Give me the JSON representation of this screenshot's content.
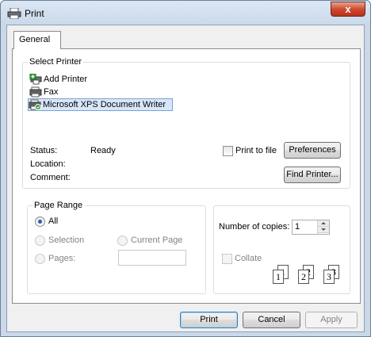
{
  "window": {
    "title": "Print",
    "close_symbol": "x"
  },
  "tabs": [
    {
      "label": "General"
    }
  ],
  "select_printer": {
    "group_label": "Select Printer",
    "printers": [
      {
        "label": "Add Printer",
        "icon": "add-printer-icon",
        "selected": false
      },
      {
        "label": "Fax",
        "icon": "fax-icon",
        "selected": false
      },
      {
        "label": "Microsoft XPS Document Writer",
        "icon": "printer-default-icon",
        "selected": true
      }
    ],
    "status_label": "Status:",
    "status_value": "Ready",
    "location_label": "Location:",
    "comment_label": "Comment:",
    "print_to_file_label": "Print to file",
    "print_to_file_checked": false,
    "preferences_label": "Preferences",
    "find_printer_label": "Find Printer..."
  },
  "page_range": {
    "group_label": "Page Range",
    "all_label": "All",
    "selection_label": "Selection",
    "current_page_label": "Current Page",
    "pages_label": "Pages:",
    "pages_value": "",
    "selected_option": "All"
  },
  "copies": {
    "label": "Number of copies:",
    "value": "1",
    "collate_label": "Collate",
    "collate_checked": false,
    "collate_pages": [
      {
        "back": "1",
        "front": "1"
      },
      {
        "back": "2",
        "front": "2"
      },
      {
        "back": "3",
        "front": "3"
      }
    ]
  },
  "footer": {
    "print_label": "Print",
    "cancel_label": "Cancel",
    "apply_label": "Apply"
  }
}
